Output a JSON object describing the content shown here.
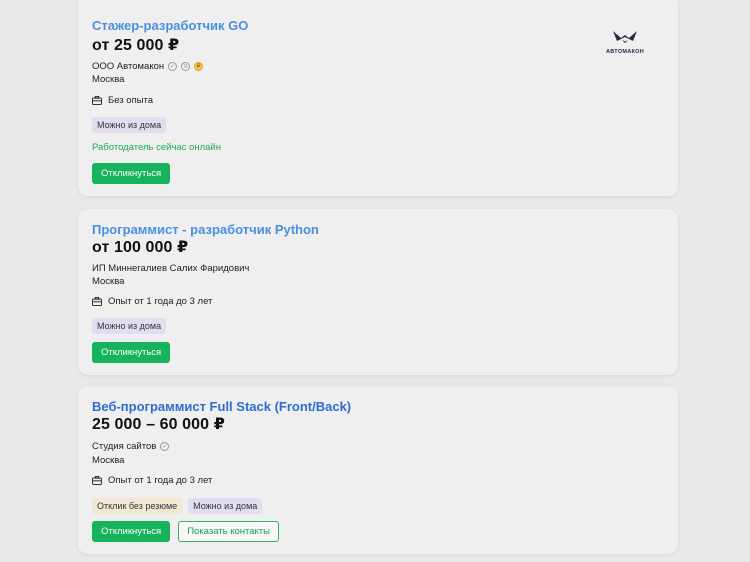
{
  "vacancies": [
    {
      "title": "Стажер-разработчик GO",
      "salary": "от 25 000 ₽",
      "company": "ООО Автомакон",
      "city": "Москва",
      "experience": "Без опыта",
      "tags": [
        "Можно из дома"
      ],
      "online": "Работодатель сейчас онлайн",
      "respond": "Откликнуться",
      "logo_text": "АВТОМАКОН"
    },
    {
      "title": "Программист - разработчик Python",
      "salary": "от 100 000 ₽",
      "company": "ИП Миннегалиев Салих Фаридович",
      "city": "Москва",
      "experience": "Опыт от 1 года до 3 лет",
      "tags": [
        "Можно из дома"
      ],
      "respond": "Откликнуться"
    },
    {
      "title": "Веб-программист Full Stack (Front/Back)",
      "salary": "25 000 – 60 000 ₽",
      "company": "Студия сайтов",
      "city": "Москва",
      "experience": "Опыт от 1 года до 3 лет",
      "tags": [
        "Отклик без резюме",
        "Можно из дома"
      ],
      "respond": "Откликнуться",
      "show_contacts": "Показать контакты"
    }
  ],
  "colors": {
    "title": "#4a8fe0",
    "title_visited": "#2f6cd1",
    "green": "#17b35c",
    "tag_purple": "#e2def0",
    "tag_yellow": "#efe9d3"
  },
  "icons": {
    "verified": "check-circle-icon",
    "trusted": "id-card-icon",
    "rating": "gold-coin-icon",
    "experience": "briefcase-icon"
  }
}
